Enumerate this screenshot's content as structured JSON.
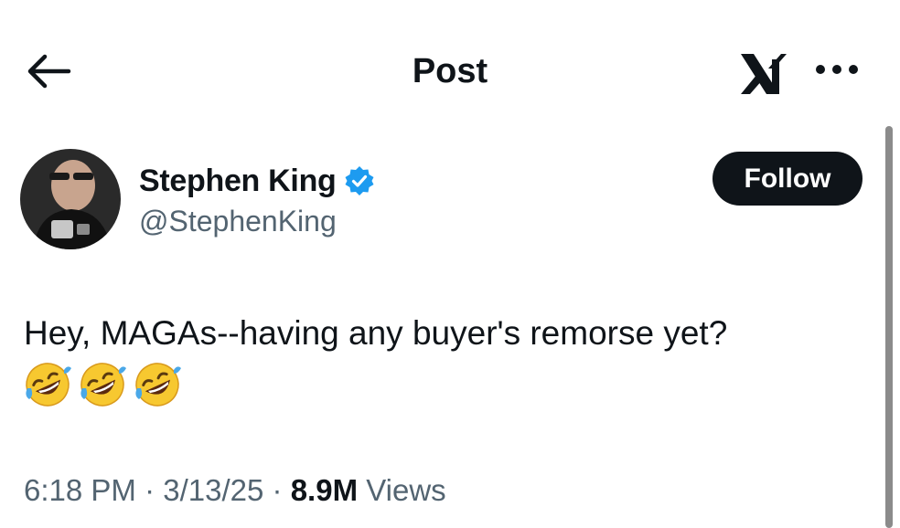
{
  "header": {
    "title": "Post",
    "back_icon": "arrow-left-icon",
    "brand_icon": "x-logo-icon",
    "more_icon": "more-horizontal-icon"
  },
  "author": {
    "name": "Stephen King",
    "handle": "@StephenKing",
    "verified_icon": "verified-badge-icon",
    "verified_color": "#1d9bf0",
    "avatar_icon": "avatar"
  },
  "follow_button": {
    "label": "Follow"
  },
  "post": {
    "text": "Hey, MAGAs--having any buyer's remorse yet?",
    "emojis": [
      "🤣",
      "🤣",
      "🤣"
    ]
  },
  "meta": {
    "time": "6:18 PM",
    "separator": "·",
    "date": "3/13/25",
    "views_count": "8.9M",
    "views_label": "Views"
  },
  "colors": {
    "text_primary": "#0f1419",
    "text_secondary": "#536471",
    "button_bg": "#0f1419",
    "button_text": "#ffffff"
  }
}
